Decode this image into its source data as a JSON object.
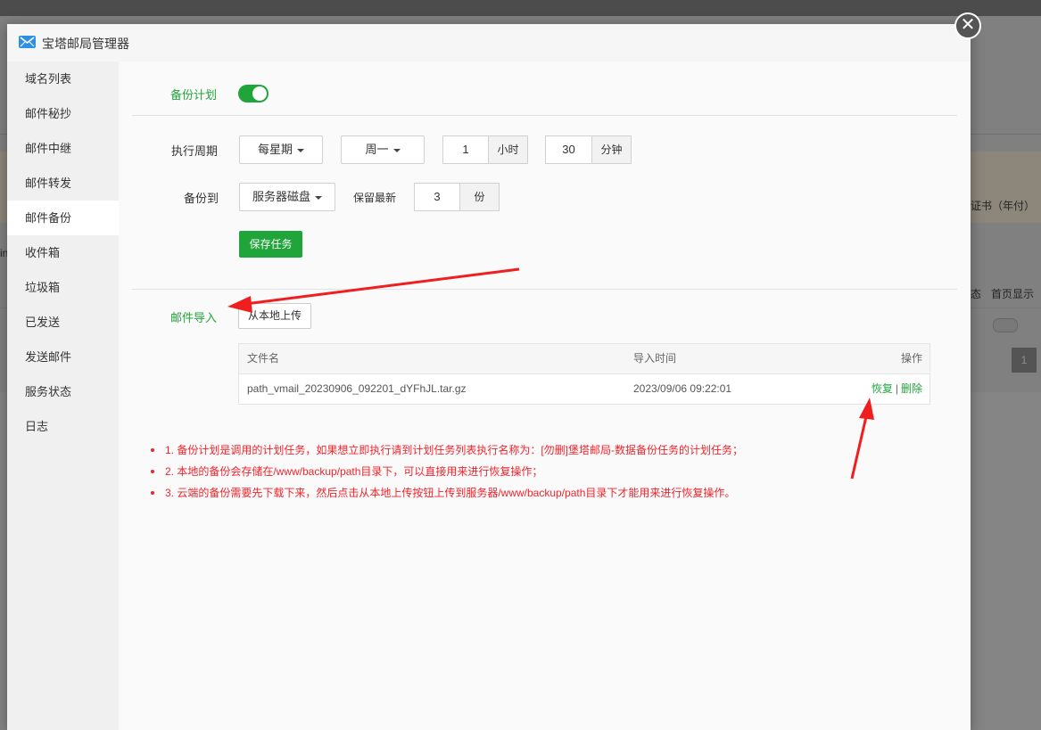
{
  "dialog": {
    "title": "宝塔邮局管理器",
    "close_glyph": "✕"
  },
  "sidebar": {
    "items": [
      {
        "label": "域名列表"
      },
      {
        "label": "邮件秘抄"
      },
      {
        "label": "邮件中继"
      },
      {
        "label": "邮件转发"
      },
      {
        "label": "邮件备份"
      },
      {
        "label": "收件箱"
      },
      {
        "label": "垃圾箱"
      },
      {
        "label": "已发送"
      },
      {
        "label": "发送邮件"
      },
      {
        "label": "服务状态"
      },
      {
        "label": "日志"
      }
    ],
    "active_index": 4
  },
  "backup_plan": {
    "label": "备份计划",
    "enabled": true,
    "cycle_label": "执行周期",
    "cycle_value": "每星期",
    "weekday_value": "周一",
    "hour_value": "1",
    "hour_unit": "小时",
    "minute_value": "30",
    "minute_unit": "分钟",
    "backup_to_label": "备份到",
    "backup_to_value": "服务器磁盘",
    "keep_label": "保留最新",
    "keep_value": "3",
    "keep_unit": "份",
    "save_button": "保存任务"
  },
  "mail_import": {
    "label": "邮件导入",
    "upload_button": "从本地上传",
    "table": {
      "headers": {
        "filename": "文件名",
        "import_time": "导入时间",
        "actions": "操作"
      },
      "rows": [
        {
          "filename": "path_vmail_20230906_092201_dYFhJL.tar.gz",
          "import_time": "2023/09/06 09:22:01",
          "restore": "恢复",
          "separator": "|",
          "delete": "删除"
        }
      ]
    }
  },
  "notes": [
    "1. 备份计划是调用的计划任务，如果想立即执行请到计划任务列表执行名称为：[勿删]堡塔邮局-数据备份任务的计划任务；",
    "2. 本地的备份会存储在/www/backup/path目录下，可以直接用来进行恢复操作；",
    "3. 云端的备份需要先下载下来，然后点击从本地上传按钮上传到服务器/www/backup/path目录下才能用来进行恢复操作。"
  ],
  "background": {
    "right_text_1": "证书（年付）",
    "right_text_2": "首页显示",
    "right_text_3": "态",
    "page_num": "1",
    "left_text": "in"
  },
  "colors": {
    "accent_green": "#20a53a",
    "note_red": "#f0242c",
    "arrow_red": "#f01f1f"
  }
}
